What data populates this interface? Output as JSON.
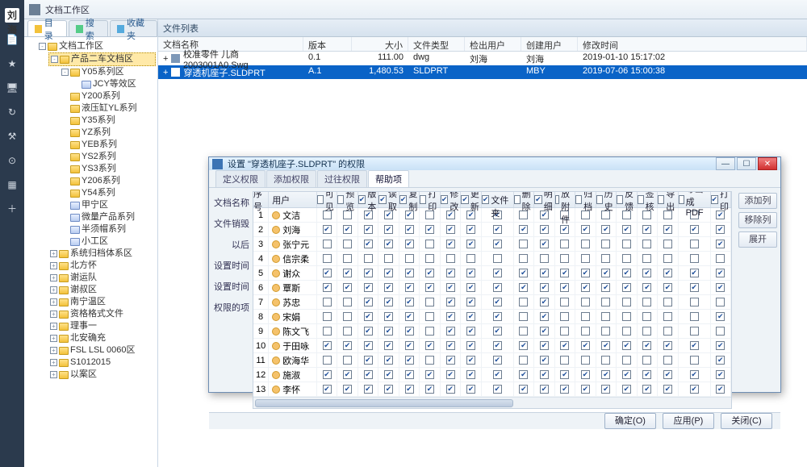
{
  "title": "文档工作区",
  "rail": {
    "items": [
      "刘海",
      "📄",
      "★",
      "🖥",
      "↻",
      "⚒",
      "⊙",
      "▦",
      "＋"
    ]
  },
  "leftTabs": [
    {
      "label": "目录",
      "icon": "#f3c23b"
    },
    {
      "label": "搜索",
      "icon": "#5c8"
    },
    {
      "label": "收藏夹",
      "icon": "#5ad"
    }
  ],
  "tree": {
    "root": "文档工作区",
    "branch": {
      "label": "产品二车文档区",
      "children": [
        {
          "label": "Y05系列区",
          "children": [
            {
              "label": "JCY等效区"
            }
          ]
        },
        {
          "label": "Y200系列"
        },
        {
          "label": "液压缸YL系列"
        },
        {
          "label": "Y35系列"
        },
        {
          "label": "YZ系列"
        },
        {
          "label": "YEB系列"
        },
        {
          "label": "YS2系列"
        },
        {
          "label": "YS3系列"
        },
        {
          "label": "Y206系列"
        },
        {
          "label": "Y54系列"
        },
        {
          "label": "甲宁区"
        },
        {
          "label": "微量产品系列"
        },
        {
          "label": "半须帽系列"
        },
        {
          "label": "小工区"
        }
      ]
    },
    "rest": [
      "系统归档体系区",
      "北方怀",
      "谢运队",
      "谢叔区",
      "南宁温区",
      "资格格式文件",
      "理事一",
      "北安确充",
      "FSL LSL 0060区",
      "S1012015",
      "以案区"
    ]
  },
  "filelist": {
    "panelTitle": "文件列表",
    "cols": [
      "文档名称",
      "版本",
      "大小",
      "文件类型",
      "检出用户",
      "创建用户",
      "修改时间"
    ],
    "rows": [
      {
        "name": "校准零件 儿商2003001A0.Swg",
        "ver": "0.1",
        "size": "111.00",
        "type": "dwg",
        "chk": "刘海",
        "user": "刘海",
        "time": "2019-01-10 15:17:02",
        "sel": false
      },
      {
        "name": "穿透机座子.SLDPRT",
        "ver": "A.1",
        "size": "1,480.53",
        "type": "SLDPRT",
        "chk": "",
        "user": "MBY",
        "time": "2019-07-06 15:00:38",
        "sel": true
      }
    ]
  },
  "modal": {
    "title": "设置 \"穿透机座子.SLDPRT\" 的权限",
    "tabs": [
      "定义权限",
      "添加权限",
      "过往权限",
      "帮助项"
    ],
    "sideLabels": [
      "文档名称",
      "文件销毁",
      "以后",
      "设置时间",
      "设置时间",
      "权限的项"
    ],
    "rightButtons": [
      "添加列",
      "移除列",
      "展开"
    ],
    "cols": [
      "序号",
      "用户",
      "可见",
      "预览",
      "版本",
      "读取",
      "复制",
      "打印",
      "修改",
      "更新",
      "新版文件夹",
      "删除",
      "明细",
      "发放附件",
      "归档",
      "历史",
      "反馈",
      "签核",
      "导出",
      "导出成PDF",
      "打印"
    ],
    "headChecked": [
      null,
      null,
      0,
      0,
      1,
      1,
      1,
      0,
      1,
      1,
      1,
      0,
      1,
      0,
      0,
      0,
      0,
      0,
      0,
      0,
      1
    ],
    "rows": [
      {
        "n": 1,
        "u": "文洁",
        "c": [
          0,
          0,
          1,
          1,
          1,
          0,
          1,
          1,
          1,
          0,
          1,
          0,
          0,
          0,
          0,
          0,
          0,
          0,
          1
        ]
      },
      {
        "n": 2,
        "u": "刘海",
        "c": [
          1,
          1,
          1,
          1,
          1,
          1,
          1,
          1,
          1,
          1,
          1,
          1,
          1,
          1,
          1,
          1,
          1,
          1,
          1
        ]
      },
      {
        "n": 3,
        "u": "张宁元",
        "c": [
          0,
          0,
          1,
          1,
          1,
          0,
          1,
          1,
          1,
          0,
          1,
          0,
          0,
          0,
          0,
          0,
          0,
          0,
          1
        ]
      },
      {
        "n": 4,
        "u": "信宗柔",
        "c": [
          0,
          0,
          0,
          0,
          0,
          0,
          0,
          0,
          0,
          0,
          0,
          0,
          0,
          0,
          0,
          0,
          0,
          0,
          0
        ]
      },
      {
        "n": 5,
        "u": "谢众",
        "c": [
          1,
          1,
          1,
          1,
          1,
          1,
          1,
          1,
          1,
          1,
          1,
          1,
          1,
          1,
          1,
          1,
          1,
          1,
          1
        ]
      },
      {
        "n": 6,
        "u": "覃斯",
        "c": [
          1,
          1,
          1,
          1,
          1,
          1,
          1,
          1,
          1,
          1,
          1,
          1,
          1,
          1,
          1,
          1,
          1,
          1,
          1
        ]
      },
      {
        "n": 7,
        "u": "苏忠",
        "c": [
          0,
          0,
          1,
          1,
          1,
          0,
          1,
          1,
          1,
          0,
          1,
          0,
          0,
          0,
          0,
          0,
          0,
          0,
          0
        ]
      },
      {
        "n": 8,
        "u": "宋娟",
        "c": [
          0,
          0,
          1,
          1,
          1,
          0,
          1,
          1,
          1,
          0,
          1,
          0,
          0,
          0,
          0,
          0,
          0,
          0,
          1
        ]
      },
      {
        "n": 9,
        "u": "陈文飞",
        "c": [
          0,
          0,
          1,
          1,
          1,
          0,
          1,
          1,
          1,
          0,
          1,
          0,
          0,
          0,
          0,
          0,
          0,
          0,
          0
        ]
      },
      {
        "n": 10,
        "u": "于田咏",
        "c": [
          1,
          1,
          1,
          1,
          1,
          1,
          1,
          1,
          1,
          1,
          1,
          1,
          1,
          1,
          1,
          1,
          1,
          1,
          1
        ]
      },
      {
        "n": 11,
        "u": "欧海华",
        "c": [
          0,
          0,
          1,
          1,
          1,
          0,
          1,
          1,
          1,
          0,
          1,
          0,
          0,
          0,
          0,
          0,
          0,
          0,
          1
        ]
      },
      {
        "n": 12,
        "u": "施淑",
        "c": [
          1,
          1,
          1,
          1,
          1,
          1,
          1,
          1,
          1,
          1,
          1,
          1,
          1,
          1,
          1,
          1,
          1,
          1,
          1
        ]
      },
      {
        "n": 13,
        "u": "李怀",
        "c": [
          1,
          1,
          1,
          1,
          1,
          1,
          1,
          1,
          1,
          1,
          1,
          1,
          1,
          1,
          1,
          1,
          1,
          1,
          1
        ]
      }
    ],
    "footer": [
      "确定(O)",
      "应用(P)",
      "关闭(C)"
    ]
  }
}
